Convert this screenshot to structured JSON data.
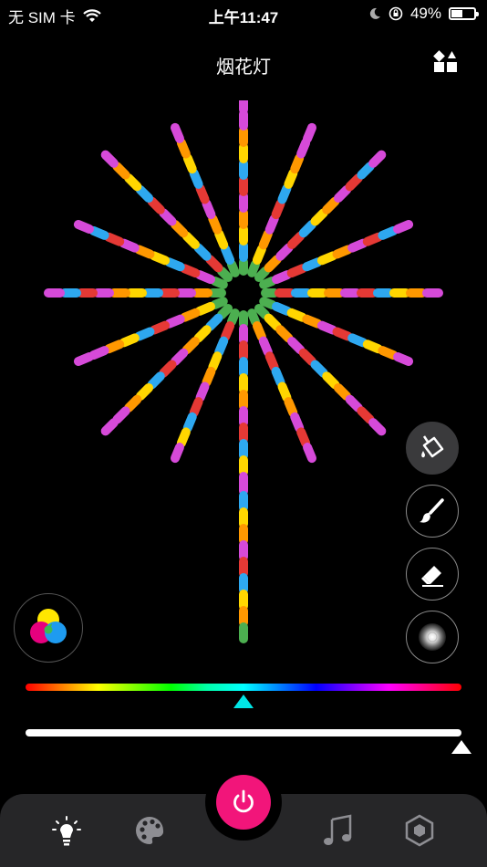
{
  "status_bar": {
    "carrier": "无 SIM 卡",
    "time": "上午11:47",
    "battery": "49%",
    "battery_level": 0.49
  },
  "header": {
    "title": "烟花灯"
  },
  "strip_colors": [
    "#e53935",
    "#2ea8f0",
    "#ffd600",
    "#ff9800",
    "#d64ad9"
  ],
  "center_color": "#4caf50",
  "tip_color": "#d64ad9",
  "tools": [
    {
      "name": "fill-bucket-tool",
      "icon": "fill-bucket-icon",
      "active": true
    },
    {
      "name": "brush-tool",
      "icon": "brush-icon",
      "active": false
    },
    {
      "name": "eraser-tool",
      "icon": "eraser-icon",
      "active": false
    },
    {
      "name": "gradient-tool",
      "icon": "radial-gradient-icon",
      "active": false
    }
  ],
  "hue_slider": {
    "position": 0.5,
    "thumb_color": "#00e5e5"
  },
  "brightness_slider": {
    "position": 1.0
  },
  "bottom_nav": [
    {
      "name": "nav-light",
      "icon": "light-bulb-icon",
      "active": true
    },
    {
      "name": "nav-palette",
      "icon": "palette-icon",
      "active": false
    },
    {
      "name": "nav-power",
      "icon": "power-icon"
    },
    {
      "name": "nav-music",
      "icon": "music-note-icon",
      "active": false
    },
    {
      "name": "nav-device",
      "icon": "hexagon-nut-icon",
      "active": false
    }
  ],
  "power_color": "#f2157a"
}
